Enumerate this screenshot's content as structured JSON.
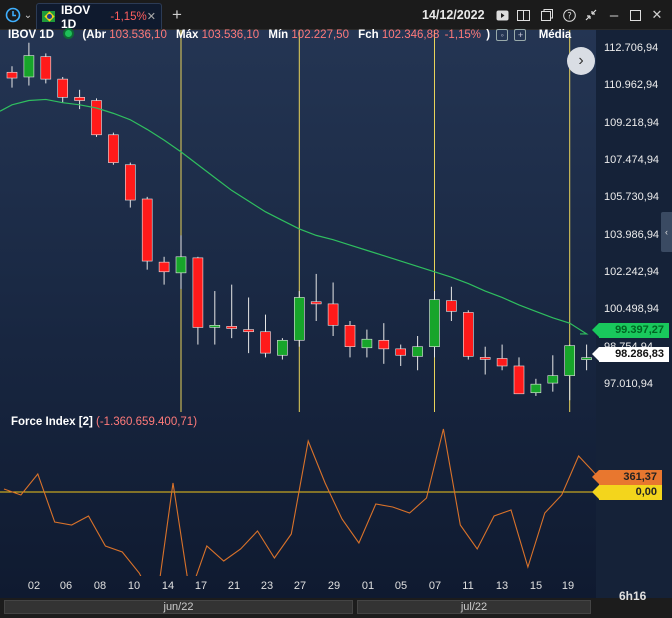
{
  "tab": {
    "symbol": "IBOV 1D",
    "change": "-1,15%"
  },
  "date": "14/12/2022",
  "header": {
    "symbol": "IBOV 1D",
    "open_label": "Abr",
    "open": "103.536,10",
    "high_label": "Máx",
    "high": "103.536,10",
    "low_label": "Mín",
    "low": "102.227,50",
    "close_label": "Fch",
    "close": "102.346,88",
    "change": "-1,15%",
    "close_paren": ")",
    "ma_label": "Média"
  },
  "force_index": {
    "title": "Force Index [2]",
    "value": "(-1.360.659.400,71)"
  },
  "price_ticks": [
    "112.706,94",
    "110.962,94",
    "109.218,94",
    "107.474,94",
    "105.730,94",
    "103.986,94",
    "102.242,94",
    "100.498,94",
    "98.754,94",
    "97.010,94"
  ],
  "badges": {
    "ma_value": "99.397,27",
    "last_price": "98.286,83",
    "force_value": "361,37",
    "zero_line": "0,00"
  },
  "x_labels": [
    "02",
    "06",
    "08",
    "10",
    "14",
    "17",
    "21",
    "23",
    "27",
    "29",
    "01",
    "05",
    "07",
    "11",
    "13",
    "15",
    "19"
  ],
  "periods": [
    "jun/22",
    "jul/22"
  ],
  "time_left": "6h16",
  "colors": {
    "up": "#17a52a",
    "down": "#ff1a1a",
    "ma": "#2fbf5f",
    "force": "#d9722a",
    "zero": "#f0c419",
    "vline": "#e8d35a"
  },
  "chart_data": {
    "type": "candlestick",
    "price_axis": {
      "min": 96500,
      "max": 113500
    },
    "candles": [
      {
        "date": "31/05",
        "o": 111620,
        "h": 111900,
        "l": 110900,
        "c": 111350
      },
      {
        "date": "01/06",
        "o": 111400,
        "h": 113000,
        "l": 111000,
        "c": 112400
      },
      {
        "date": "02/06",
        "o": 112350,
        "h": 112500,
        "l": 111100,
        "c": 111300
      },
      {
        "date": "03/06",
        "o": 111300,
        "h": 111400,
        "l": 110200,
        "c": 110450
      },
      {
        "date": "06/06",
        "o": 110450,
        "h": 110800,
        "l": 109900,
        "c": 110300
      },
      {
        "date": "07/06",
        "o": 110300,
        "h": 110400,
        "l": 108600,
        "c": 108700
      },
      {
        "date": "08/06",
        "o": 108700,
        "h": 108800,
        "l": 107300,
        "c": 107400
      },
      {
        "date": "09/06",
        "o": 107300,
        "h": 107400,
        "l": 105300,
        "c": 105650
      },
      {
        "date": "10/06",
        "o": 105700,
        "h": 105800,
        "l": 102400,
        "c": 102800
      },
      {
        "date": "13/06",
        "o": 102750,
        "h": 103000,
        "l": 101700,
        "c": 102300
      },
      {
        "date": "14/06",
        "o": 102250,
        "h": 104000,
        "l": 101500,
        "c": 103000
      },
      {
        "date": "15/06",
        "o": 102950,
        "h": 103000,
        "l": 98900,
        "c": 99700
      },
      {
        "date": "16/06",
        "o": 99700,
        "h": 101400,
        "l": 98900,
        "c": 99800
      },
      {
        "date": "17/06",
        "o": 99750,
        "h": 101700,
        "l": 99200,
        "c": 99650
      },
      {
        "date": "20/06",
        "o": 99600,
        "h": 101100,
        "l": 98500,
        "c": 99500
      },
      {
        "date": "21/06",
        "o": 99500,
        "h": 100300,
        "l": 98300,
        "c": 98500
      },
      {
        "date": "22/06",
        "o": 98400,
        "h": 99200,
        "l": 98200,
        "c": 99100
      },
      {
        "date": "23/06",
        "o": 99100,
        "h": 101400,
        "l": 98800,
        "c": 101100
      },
      {
        "date": "24/06",
        "o": 100900,
        "h": 102200,
        "l": 100000,
        "c": 100800
      },
      {
        "date": "27/06",
        "o": 100800,
        "h": 101800,
        "l": 99300,
        "c": 99800
      },
      {
        "date": "28/06",
        "o": 99800,
        "h": 100000,
        "l": 98300,
        "c": 98800
      },
      {
        "date": "29/06",
        "o": 98750,
        "h": 99600,
        "l": 98300,
        "c": 99150
      },
      {
        "date": "30/06",
        "o": 99100,
        "h": 99900,
        "l": 98000,
        "c": 98700
      },
      {
        "date": "01/07",
        "o": 98700,
        "h": 98900,
        "l": 97900,
        "c": 98400
      },
      {
        "date": "04/07",
        "o": 98350,
        "h": 99300,
        "l": 97700,
        "c": 98800
      },
      {
        "date": "05/07",
        "o": 98800,
        "h": 101400,
        "l": 98300,
        "c": 101000
      },
      {
        "date": "06/07",
        "o": 100950,
        "h": 101600,
        "l": 100000,
        "c": 100450
      },
      {
        "date": "07/07",
        "o": 100400,
        "h": 100500,
        "l": 98200,
        "c": 98350
      },
      {
        "date": "08/07",
        "o": 98300,
        "h": 98800,
        "l": 97500,
        "c": 98250
      },
      {
        "date": "11/07",
        "o": 98250,
        "h": 98900,
        "l": 97700,
        "c": 97900
      },
      {
        "date": "12/07",
        "o": 97900,
        "h": 98300,
        "l": 96600,
        "c": 96600
      },
      {
        "date": "13/07",
        "o": 96650,
        "h": 97300,
        "l": 96500,
        "c": 97050
      },
      {
        "date": "14/07",
        "o": 97100,
        "h": 98400,
        "l": 96700,
        "c": 97450
      },
      {
        "date": "15/07",
        "o": 97450,
        "h": 98900,
        "l": 96300,
        "c": 98850
      },
      {
        "date": "18/07",
        "o": 98280,
        "h": 98900,
        "l": 97700,
        "c": 98290
      }
    ],
    "moving_average": [
      110100,
      110300,
      110350,
      110200,
      110100,
      109950,
      109700,
      109400,
      108950,
      108450,
      107900,
      107300,
      106700,
      106100,
      105600,
      105100,
      104700,
      104300,
      104000,
      103800,
      103550,
      103300,
      103050,
      102800,
      102550,
      102300,
      102050,
      101750,
      101400,
      101100,
      100750,
      100450,
      100150,
      99900,
      99400
    ],
    "force_index": {
      "values": [
        0.05,
        -0.05,
        0.3,
        -0.5,
        -0.55,
        -0.4,
        -0.9,
        -1.0,
        -1.35,
        -1.9,
        0.15,
        -1.7,
        -0.9,
        -1.15,
        -0.95,
        -0.65,
        -1.1,
        -0.7,
        0.85,
        0.15,
        -0.45,
        -0.85,
        -0.2,
        -0.25,
        -0.35,
        -0.1,
        1.05,
        -0.55,
        -0.95,
        -0.4,
        -0.3,
        -1.25,
        -0.35,
        -0.05,
        0.6,
        0.3
      ],
      "zero_line": 0
    },
    "vertical_lines": [
      "14/06",
      "23/06",
      "05/07",
      "15/07"
    ]
  }
}
